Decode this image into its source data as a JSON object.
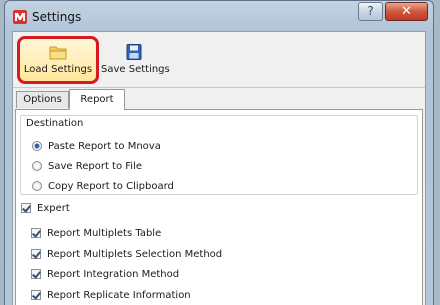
{
  "window": {
    "title": "Settings",
    "help_label": "?",
    "close_label": "✕",
    "accent_color": "#d71920"
  },
  "ribbon": {
    "load_label": "Load Settings",
    "load_icon": "folder-icon",
    "save_label": "Save Settings",
    "save_icon": "floppy-disk-icon"
  },
  "tabs": [
    {
      "label": "Options",
      "active": false
    },
    {
      "label": "Report",
      "active": true
    }
  ],
  "destination": {
    "title": "Destination",
    "options": [
      {
        "label": "Paste Report to Mnova",
        "selected": true
      },
      {
        "label": "Save Report to File",
        "selected": false
      },
      {
        "label": "Copy Report to Clipboard",
        "selected": false
      }
    ]
  },
  "expert": {
    "label": "Expert",
    "checked": true
  },
  "report_options": [
    {
      "label": "Report Multiplets Table",
      "checked": true
    },
    {
      "label": "Report Multiplets Selection Method",
      "checked": true
    },
    {
      "label": "Report Integration Method",
      "checked": true
    },
    {
      "label": "Report Replicate Information",
      "checked": true
    }
  ]
}
